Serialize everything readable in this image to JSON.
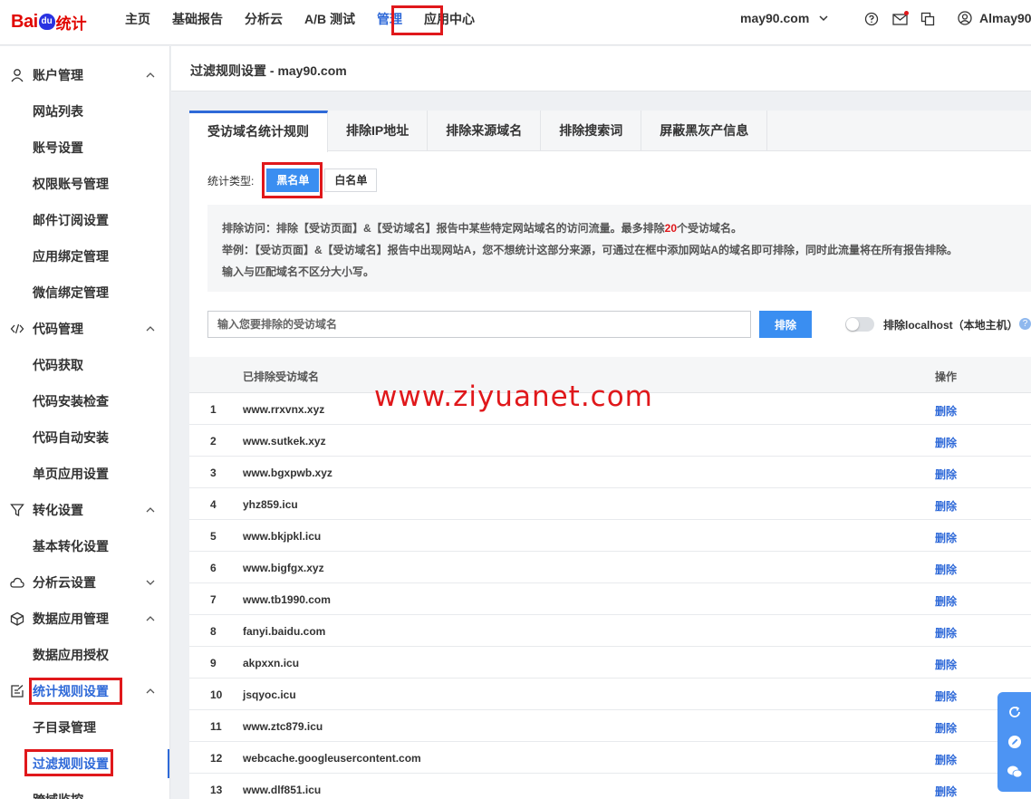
{
  "logo": {
    "text_bai": "Bai",
    "text_du": "du",
    "text_tongji": "统计"
  },
  "nav": [
    "主页",
    "基础报告",
    "分析云",
    "A/B 测试",
    "管理",
    "应用中心"
  ],
  "site": {
    "name": "may90.com"
  },
  "user": {
    "name": "Almay90"
  },
  "sidebar": {
    "groups": [
      {
        "label": "账户管理",
        "icon": "user-icon",
        "items": [
          "网站列表",
          "账号设置",
          "权限账号管理",
          "邮件订阅设置",
          "应用绑定管理",
          "微信绑定管理"
        ]
      },
      {
        "label": "代码管理",
        "icon": "code-icon",
        "items": [
          "代码获取",
          "代码安装检查",
          "代码自动安装",
          "单页应用设置"
        ]
      },
      {
        "label": "转化设置",
        "icon": "funnel-icon",
        "items": [
          "基本转化设置"
        ]
      },
      {
        "label": "分析云设置",
        "icon": "cloud-icon",
        "items": []
      },
      {
        "label": "数据应用管理",
        "icon": "cube-icon",
        "items": [
          "数据应用授权"
        ]
      },
      {
        "label": "统计规则设置",
        "icon": "rules-icon",
        "items": [
          "子目录管理",
          "过滤规则设置",
          "跨域监控"
        ]
      }
    ]
  },
  "page": {
    "title": "过滤规则设置 - may90.com"
  },
  "tabs": [
    "受访域名统计规则",
    "排除IP地址",
    "排除来源域名",
    "排除搜索词",
    "屏蔽黑灰产信息"
  ],
  "stat_type": {
    "label": "统计类型:",
    "options": [
      "黑名单",
      "白名单"
    ]
  },
  "info": {
    "line1_a": "排除访问：排除【受访页面】&【受访域名】报告中某些特定网站域名的访问流量。最多排除",
    "line1_num": "20",
    "line1_b": "个受访域名。",
    "line2": "举例：【受访页面】&【受访域名】报告中出现网站A，您不想统计这部分来源，可通过在框中添加网站A的域名即可排除，同时此流量将在所有报告排除。",
    "line3": "输入与匹配域名不区分大小写。"
  },
  "input": {
    "placeholder": "输入您要排除的受访域名",
    "button": "排除",
    "toggle_label": "排除localhost（本地主机）",
    "toggle_on": false
  },
  "table": {
    "headers": {
      "domain": "已排除受访域名",
      "op": "操作"
    },
    "delete_label": "删除",
    "rows": [
      {
        "idx": "1",
        "domain": "www.rrxvnx.xyz"
      },
      {
        "idx": "2",
        "domain": "www.sutkek.xyz"
      },
      {
        "idx": "3",
        "domain": "www.bgxpwb.xyz"
      },
      {
        "idx": "4",
        "domain": "yhz859.icu"
      },
      {
        "idx": "5",
        "domain": "www.bkjpkl.icu"
      },
      {
        "idx": "6",
        "domain": "www.bigfgx.xyz"
      },
      {
        "idx": "7",
        "domain": "www.tb1990.com"
      },
      {
        "idx": "8",
        "domain": "fanyi.baidu.com"
      },
      {
        "idx": "9",
        "domain": "akpxxn.icu"
      },
      {
        "idx": "10",
        "domain": "jsqyoc.icu"
      },
      {
        "idx": "11",
        "domain": "www.ztc879.icu"
      },
      {
        "idx": "12",
        "domain": "webcache.googleusercontent.com"
      },
      {
        "idx": "13",
        "domain": "www.dlf851.icu"
      }
    ]
  },
  "watermark": "www.ziyuanet.com",
  "colors": {
    "accent": "#2e69d8",
    "button": "#3a8ef1",
    "highlight_box": "#e0181b",
    "float_bar": "#4d94f3"
  }
}
